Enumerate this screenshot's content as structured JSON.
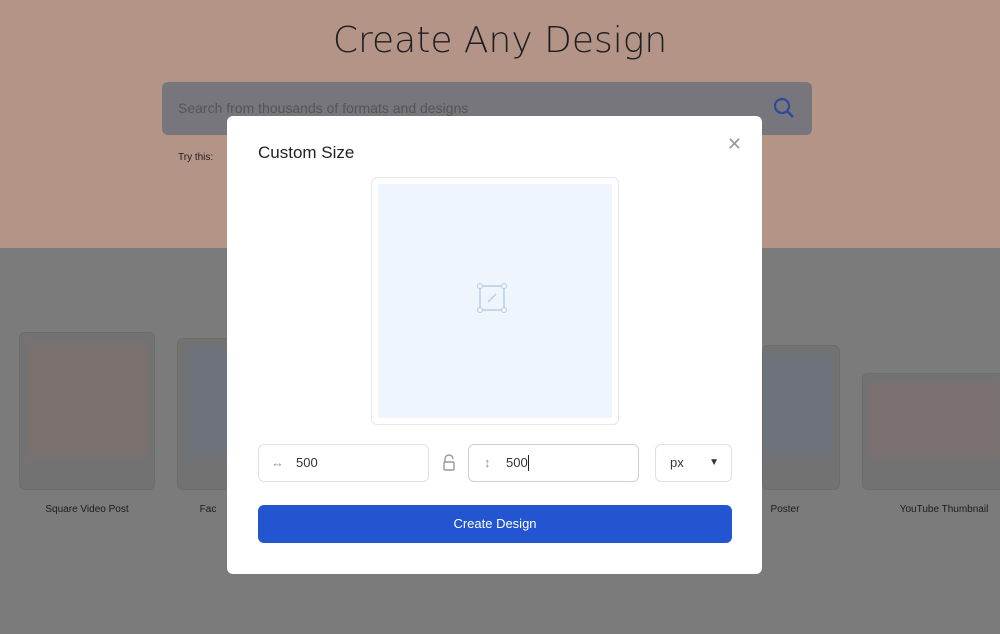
{
  "page": {
    "title": "Create Any Design",
    "search_placeholder": "Search from thousands of formats and designs",
    "try_this": "Try this:",
    "cards": [
      {
        "label": "Square Video Post"
      },
      {
        "label": "Fac"
      },
      {
        "label": "Poster"
      },
      {
        "label": "YouTube Thumbnail"
      }
    ]
  },
  "modal": {
    "title": "Custom Size",
    "close_icon": "close-icon",
    "width_value": "500",
    "height_value": "500",
    "unit": "px",
    "submit_label": "Create Design",
    "accent_color": "#2355d0"
  }
}
